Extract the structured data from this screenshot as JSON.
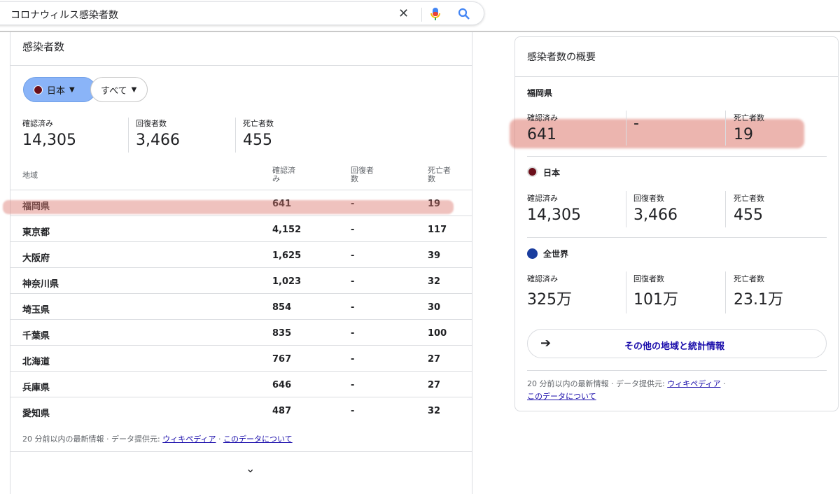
{
  "search": {
    "query": "コロナウィルス感染者数",
    "clear_icon": "close-icon",
    "mic_icon": "mic-icon",
    "search_icon": "search-icon"
  },
  "left_card": {
    "title": "感染者数",
    "chip_country": "日本",
    "chip_scope": "すべて",
    "stats": [
      {
        "label": "確認済み",
        "value": "14,305"
      },
      {
        "label": "回復者数",
        "value": "3,466"
      },
      {
        "label": "死亡者数",
        "value": "455"
      }
    ],
    "table": {
      "headers": [
        "地域",
        "確認済み",
        "回復者数",
        "死亡者数"
      ],
      "rows": [
        [
          "福岡県",
          "641",
          "-",
          "19"
        ],
        [
          "東京都",
          "4,152",
          "-",
          "117"
        ],
        [
          "大阪府",
          "1,625",
          "-",
          "39"
        ],
        [
          "神奈川県",
          "1,023",
          "-",
          "32"
        ],
        [
          "埼玉県",
          "854",
          "-",
          "30"
        ],
        [
          "千葉県",
          "835",
          "-",
          "100"
        ],
        [
          "北海道",
          "767",
          "-",
          "27"
        ],
        [
          "兵庫県",
          "646",
          "-",
          "27"
        ],
        [
          "愛知県",
          "487",
          "-",
          "32"
        ]
      ]
    },
    "footer": {
      "updated": "20 分前以内の最新情報",
      "dot": "·",
      "provider_prefix": "データ提供元:",
      "provider": "ウィキペディア",
      "about": "このデータについて"
    },
    "expand_icon": "chevron-down-icon"
  },
  "right_card": {
    "title": "感染者数の概要",
    "sections": [
      {
        "region": "福岡県",
        "stats": [
          {
            "label": "確認済み",
            "value": "641"
          },
          {
            "label": "",
            "value": "-"
          },
          {
            "label": "死亡者数",
            "value": "19"
          }
        ]
      },
      {
        "region": "日本",
        "stats": [
          {
            "label": "確認済み",
            "value": "14,305"
          },
          {
            "label": "回復者数",
            "value": "3,466"
          },
          {
            "label": "死亡者数",
            "value": "455"
          }
        ]
      },
      {
        "region": "全世界",
        "stats": [
          {
            "label": "確認済み",
            "value": "325万"
          },
          {
            "label": "回復者数",
            "value": "101万"
          },
          {
            "label": "死亡者数",
            "value": "23.1万"
          }
        ]
      }
    ],
    "more_button": "その他の地域と統計情報",
    "footer": {
      "updated": "20 分前以内の最新情報",
      "dot": "·",
      "provider_prefix": "データ提供元:",
      "provider": "ウィキペディア",
      "about": "このデータについて"
    }
  },
  "colors": {
    "link": "#1a0dab",
    "highlight": "#db786e",
    "chip_active": "#8ab4f8"
  }
}
